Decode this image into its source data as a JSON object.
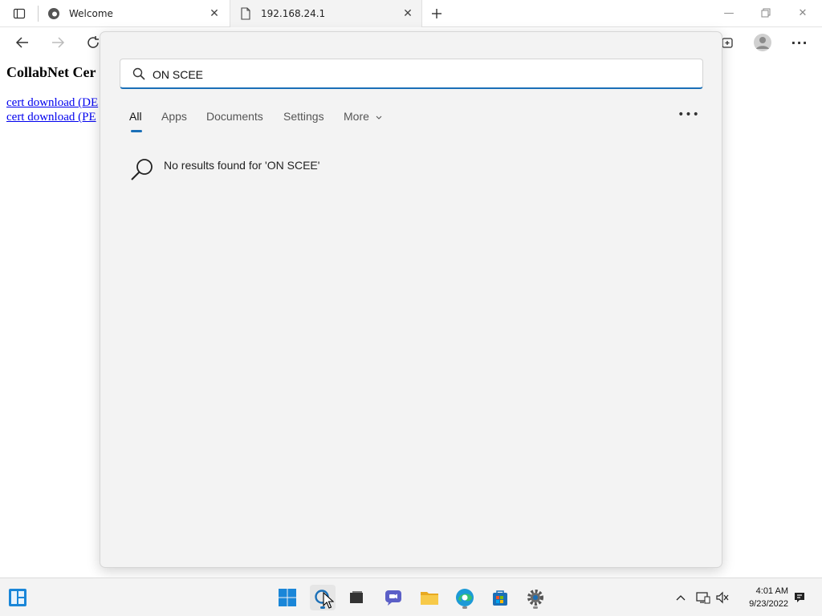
{
  "browser": {
    "tabs": [
      {
        "title": "Welcome",
        "active": false,
        "favicon": "edge-icon"
      },
      {
        "title": "192.168.24.1",
        "active": true,
        "favicon": "page-icon"
      }
    ],
    "new_tab_icon": "plus-icon"
  },
  "page": {
    "title": "CollabNet Cer",
    "links": [
      "cert download (DE",
      "cert download (PE"
    ]
  },
  "search": {
    "query": "ON SCEE",
    "filters": [
      "All",
      "Apps",
      "Documents",
      "Settings",
      "More"
    ],
    "active_filter": "All",
    "no_results": "No results found for 'ON SCEE'"
  },
  "taskbar": {
    "time": "4:01 AM",
    "date": "9/23/2022",
    "accent": "#1a6fb7"
  }
}
